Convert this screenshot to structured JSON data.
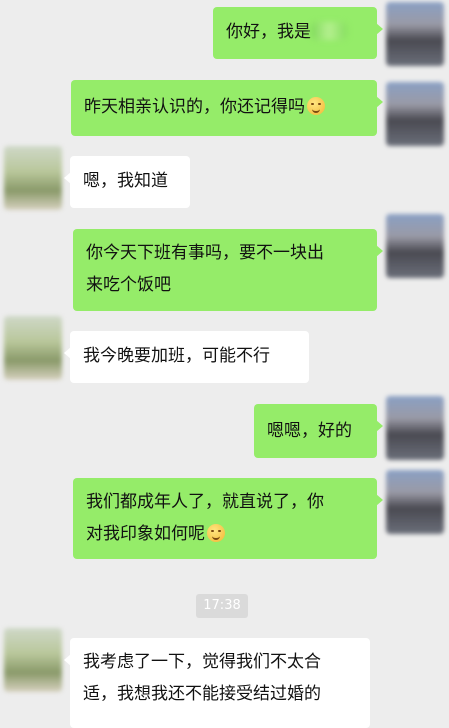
{
  "messages": [
    {
      "side": "me",
      "text": "你好，我是"
    },
    {
      "side": "me",
      "text": "昨天相亲认识的，你还记得吗"
    },
    {
      "side": "them",
      "text": "嗯，我知道"
    },
    {
      "side": "me",
      "line1": "你今天下班有事吗，要不一块出",
      "line2": "来吃个饭吧"
    },
    {
      "side": "them",
      "text": "我今晚要加班，可能不行"
    },
    {
      "side": "me",
      "text": "嗯嗯，好的"
    },
    {
      "side": "me",
      "line1": "我们都成年人了，就直说了，你",
      "line2": "对我印象如何呢"
    },
    {
      "side": "them",
      "line1": "我考虑了一下，觉得我们不太合",
      "line2": "适，我想我还不能接受结过婚的"
    }
  ],
  "timestamp": "17:38",
  "icons": {
    "emoji": "smiling-face-icon"
  },
  "colors": {
    "background": "#ededed",
    "my_bubble": "#95ec69",
    "their_bubble": "#ffffff"
  }
}
